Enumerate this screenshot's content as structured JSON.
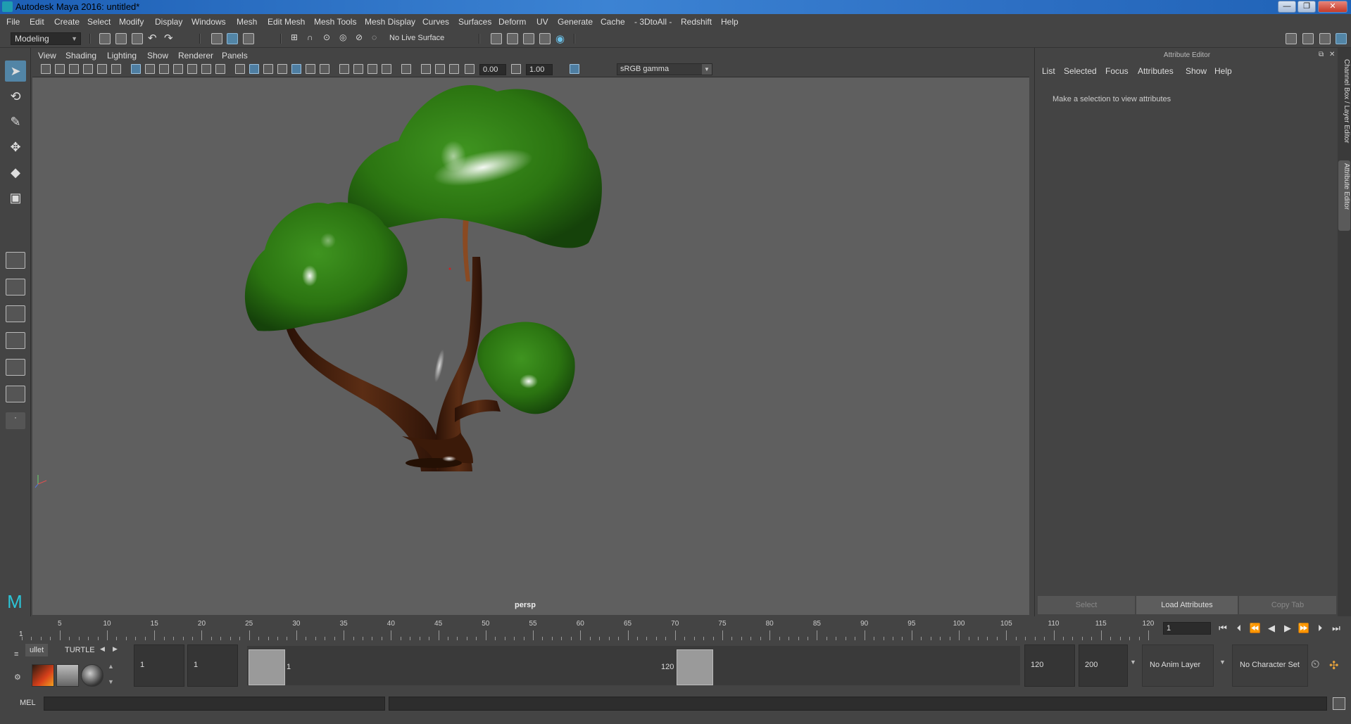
{
  "window": {
    "title": "Autodesk Maya 2016: untitled*",
    "min_label": "—",
    "max_label": "❐",
    "close_label": "✕"
  },
  "menubar": {
    "items": [
      "File",
      "Edit",
      "Create",
      "Select",
      "Modify",
      "Display",
      "Windows",
      "Mesh",
      "Edit Mesh",
      "Mesh Tools",
      "Mesh Display",
      "Curves",
      "Surfaces",
      "Deform",
      "UV",
      "Generate",
      "Cache",
      "- 3DtoAll -",
      "Redshift",
      "Help"
    ]
  },
  "statusline": {
    "mode": "Modeling",
    "live_surface": "No Live Surface"
  },
  "panel": {
    "menu": [
      "View",
      "Shading",
      "Lighting",
      "Show",
      "Renderer",
      "Panels"
    ],
    "exposure": "0.00",
    "gamma": "1.00",
    "color_space": "sRGB gamma",
    "camera": "persp"
  },
  "attribute_editor": {
    "title": "Attribute Editor",
    "menu": [
      "List",
      "Selected",
      "Focus",
      "Attributes",
      "Show",
      "Help"
    ],
    "hint": "Make a selection to view attributes",
    "buttons": {
      "select": "Select",
      "load": "Load Attributes",
      "copy": "Copy Tab"
    }
  },
  "side_tabs": {
    "channel_box": "Channel Box / Layer Editor",
    "attr_editor": "Attribute Editor"
  },
  "timeslider": {
    "labels": [
      "5",
      "10",
      "15",
      "20",
      "25",
      "30",
      "35",
      "40",
      "45",
      "50",
      "55",
      "60",
      "65",
      "70",
      "75",
      "80",
      "85",
      "90",
      "95",
      "100",
      "105",
      "110",
      "115",
      "120"
    ],
    "current": "1",
    "frame_field": "1"
  },
  "shelf": {
    "tabs": [
      "ullet",
      "TURTLE"
    ]
  },
  "range": {
    "start": "1",
    "playback_start": "1",
    "handle_start": "1",
    "handle_end": "120",
    "playback_end": "120",
    "end": "200",
    "anim_layer": "No Anim Layer",
    "character_set": "No Character Set"
  },
  "commandline": {
    "label": "MEL"
  },
  "colors": {
    "accent": "#5285a6",
    "foliage": "#2e7a14",
    "trunk": "#4a2210",
    "viewport": "#5f5f5f"
  }
}
